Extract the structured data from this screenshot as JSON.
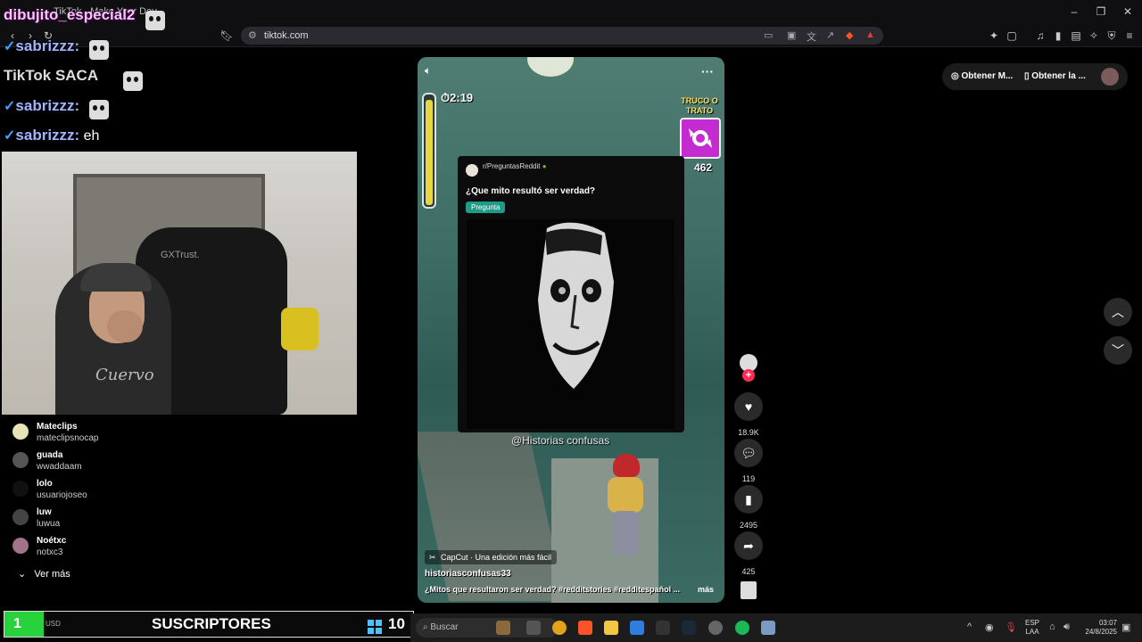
{
  "browser": {
    "tab_title": "TikTok - Make Your Day",
    "url": "tiktok.com"
  },
  "overlay": {
    "stream_title": "dibujito_especial2",
    "chat": [
      {
        "user": "sabrizzz:",
        "text": ""
      },
      {
        "user": "",
        "text": "TikTok SACA"
      },
      {
        "user": "sabrizzz:",
        "text": ""
      },
      {
        "user": "sabrizzz:",
        "text": "eh"
      }
    ],
    "webcam_chair_text": "GXTrust.",
    "webcam_shirt_text": "Cuervo"
  },
  "sidebar": {
    "accounts": [
      {
        "name": "Mateclips",
        "handle": "mateclipsnocap"
      },
      {
        "name": "guada",
        "handle": "wwaddaam"
      },
      {
        "name": "lolo",
        "handle": "usuariojoseo"
      },
      {
        "name": "luw",
        "handle": "luwua"
      },
      {
        "name": "Noétxc",
        "handle": "notxc3"
      }
    ],
    "see_more": "Ver más"
  },
  "video": {
    "timer": "2:19",
    "trick_label": "TRUCO O TRATO",
    "trick_count": "462",
    "card": {
      "subreddit": "r/PreguntasReddit",
      "question": "¿Que mito resultó ser verdad?",
      "tag": "Pregunta"
    },
    "watermark": "@Historias confusas",
    "capcut": "CapCut · Una edición más fácil",
    "author": "historiasconfusas33",
    "caption": "¿Mitos que resultaron ser verdad? #redditstories  #redditespañol  ...",
    "caption_more": "más"
  },
  "actions": {
    "likes": "18.9K",
    "comments": "119",
    "saves": "2495",
    "shares": "425"
  },
  "top_actions": {
    "get_coins": "Obtener M...",
    "get_app": "Obtener la ..."
  },
  "subscribers": {
    "left_count": "1",
    "label": "SUSCRIPTORES",
    "right_count": "10",
    "small": "USD"
  },
  "taskbar": {
    "search_placeholder": "Buscar",
    "lang_top": "ESP",
    "lang_bottom": "LAA",
    "time": "03:07",
    "date": "24/8/2025"
  },
  "colors": {
    "accent_red": "#fe2c55",
    "tag_green": "#1f9c88",
    "sub_green": "#28d23c"
  }
}
